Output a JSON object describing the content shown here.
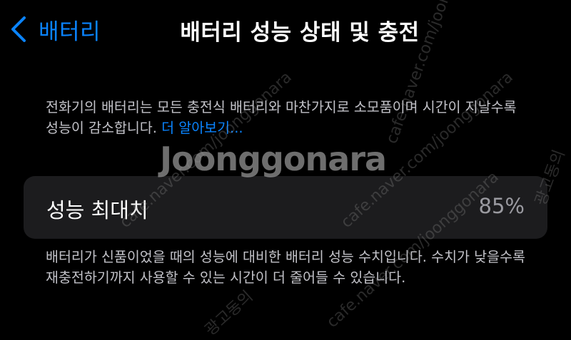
{
  "nav": {
    "back_label": "배터리",
    "title": "배터리 성능 상태 및 충전"
  },
  "description_top": {
    "text": "전화기의 배터리는 모든 충전식 배터리와 마찬가지로 소모품이며 시간이 지날수록 성능이 감소합니다.",
    "link_text": "더 알아보기..."
  },
  "max_capacity": {
    "label": "성능 최대치",
    "value": "85%"
  },
  "description_bottom": {
    "text": "배터리가 신품이었을 때의 성능에 대비한 배터리 성능 수치입니다. 수치가 낮을수록 재충전하기까지 사용할 수 있는 시간이 더 줄어들 수 있습니다."
  },
  "watermark": {
    "logo": "Joonggonara",
    "url": "cafe.naver.com/joonggonara",
    "ad_text": "광고동의"
  },
  "colors": {
    "background": "#000000",
    "accent": "#0a84ff",
    "card": "#1c1c1e",
    "secondary_text": "#c2c2c8"
  },
  "icons": {
    "back": "chevron-left-icon"
  }
}
